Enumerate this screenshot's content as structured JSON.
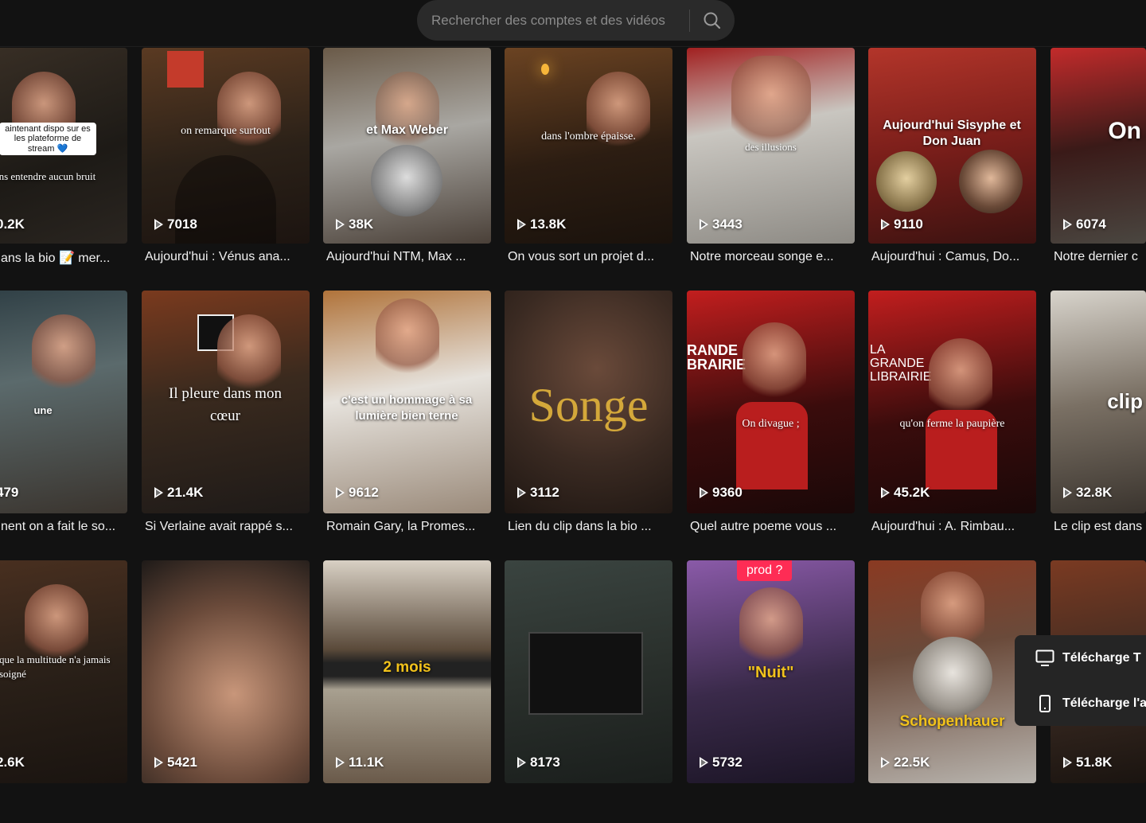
{
  "search": {
    "placeholder": "Rechercher des comptes et des vidéos"
  },
  "colors": {
    "background": "#121212",
    "accent": "#fe2c55",
    "songe_gold": "#d4a83a"
  },
  "videos": [
    {
      "views": "0.2K",
      "caption": "ans la bio 📝 mer...",
      "overlay": "sans entendre aucun bruit",
      "overlay_top": "aintenant dispo sur es les plateforme de stream 💙"
    },
    {
      "views": "7018",
      "caption": "Aujourd'hui : Vénus ana...",
      "overlay": "on remarque surtout"
    },
    {
      "views": "38K",
      "caption": "Aujourd'hui NTM, Max ...",
      "overlay": "et Max Weber"
    },
    {
      "views": "13.8K",
      "caption": "On vous sort un projet d...",
      "overlay": "dans l'ombre épaisse."
    },
    {
      "views": "3443",
      "caption": "Notre morceau songe e...",
      "overlay": "des illusions"
    },
    {
      "views": "9110",
      "caption": "Aujourd'hui : Camus, Do...",
      "overlay": "Aujourd'hui Sisyphe et Don Juan"
    },
    {
      "views": "6074",
      "caption": "Notre dernier c",
      "overlay": "On"
    },
    {
      "views": "479",
      "caption": "nent on a fait le so...",
      "overlay": "une"
    },
    {
      "views": "21.4K",
      "caption": "Si Verlaine avait rappé s...",
      "overlay": "Il pleure dans mon cœur"
    },
    {
      "views": "9612",
      "caption": "Romain Gary, la Promes...",
      "overlay": "c'est un hommage à sa lumière bien terne"
    },
    {
      "views": "3112",
      "caption": "Lien du clip dans la bio ...",
      "overlay": "Songe"
    },
    {
      "views": "9360",
      "caption": "Quel autre poeme vous ...",
      "overlay": "On divague ;",
      "overlay_top": "RANDE BRAIRIE"
    },
    {
      "views": "45.2K",
      "caption": "Aujourd'hui : A. Rimbau...",
      "overlay": "qu'on ferme la paupière",
      "overlay_top": "LA GRANDE LIBRAIRIE"
    },
    {
      "views": "32.8K",
      "caption": "Le clip est dans",
      "overlay": "clip"
    },
    {
      "views": "2.6K",
      "overlay": "que la multitude n'a jamais soigné"
    },
    {
      "views": "5421"
    },
    {
      "views": "11.1K",
      "overlay": "2 mois"
    },
    {
      "views": "8173"
    },
    {
      "views": "5732",
      "overlay": "\"Nuit\"",
      "badge": "prod ?"
    },
    {
      "views": "22.5K",
      "overlay": "Schopenhauer"
    },
    {
      "views": "51.8K"
    }
  ],
  "download_popup": {
    "item1": "Télécharge T",
    "item2": "Télécharge l'a"
  }
}
